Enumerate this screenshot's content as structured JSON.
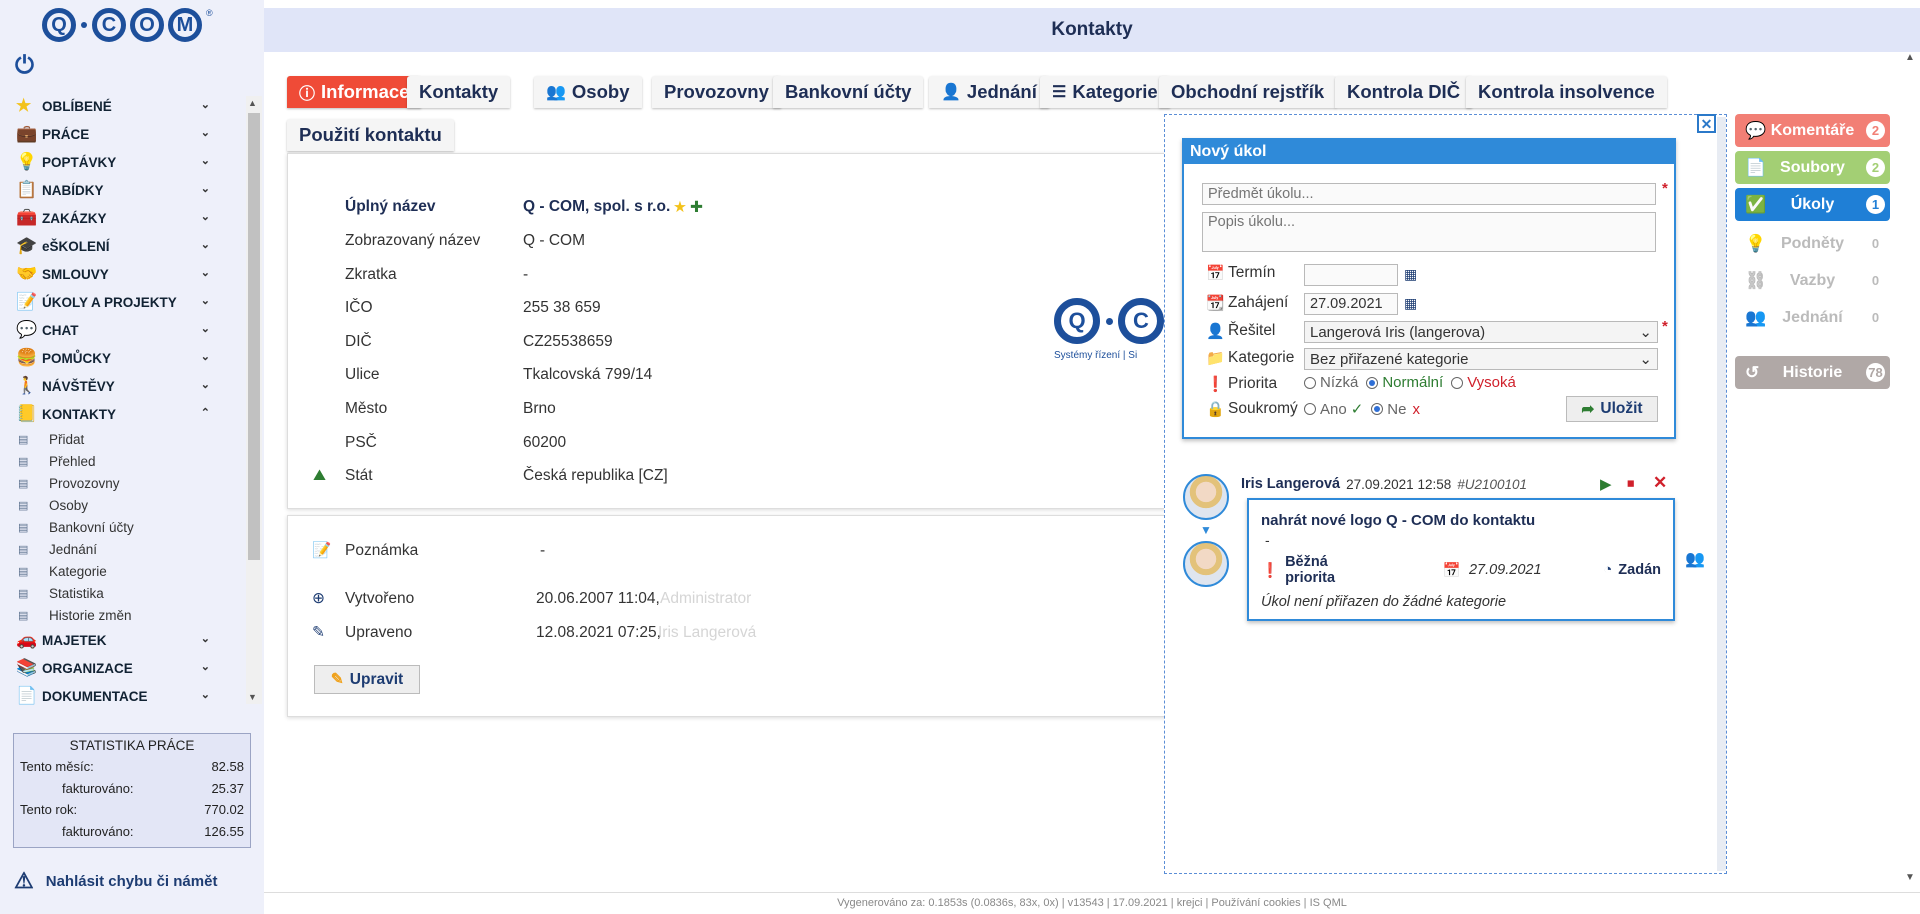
{
  "app": {
    "title": "Kontakty"
  },
  "logo": {
    "letters": [
      "Q",
      "C",
      "O",
      "M"
    ],
    "reg": "®"
  },
  "sidebar": {
    "items": [
      {
        "label": "OBLÍBENÉ",
        "icon": "star-icon",
        "glyph": "★",
        "color": "#f3c21a"
      },
      {
        "label": "PRÁCE",
        "icon": "briefcase-icon",
        "glyph": "💼",
        "color": "#b36a1a"
      },
      {
        "label": "POPTÁVKY",
        "icon": "lightbulb-icon",
        "glyph": "💡",
        "color": "#d5a11c"
      },
      {
        "label": "NABÍDKY",
        "icon": "clipboard-icon",
        "glyph": "📋",
        "color": "#2a5ea8"
      },
      {
        "label": "ZAKÁZKY",
        "icon": "toolbox-icon",
        "glyph": "🧰",
        "color": "#4d7ab0"
      },
      {
        "label": "eŠKOLENÍ",
        "icon": "graduation-cap-icon",
        "glyph": "🎓",
        "color": "#333"
      },
      {
        "label": "SMLOUVY",
        "icon": "handshake-icon",
        "glyph": "🤝",
        "color": "#4b7fb6"
      },
      {
        "label": "ÚKOLY A PROJEKTY",
        "icon": "task-clipboard-icon",
        "glyph": "📝",
        "color": "#1d4f9b"
      },
      {
        "label": "CHAT",
        "icon": "chat-icon",
        "glyph": "💬",
        "color": "#3fa0d8"
      },
      {
        "label": "POMŮCKY",
        "icon": "burger-icon",
        "glyph": "🍔",
        "color": "#c7862b"
      },
      {
        "label": "NÁVŠTĚVY",
        "icon": "walking-person-icon",
        "glyph": "🚶",
        "color": "#1d4f9b"
      },
      {
        "label": "KONTAKTY",
        "icon": "address-book-icon",
        "glyph": "📒",
        "color": "#5a6f8c"
      }
    ],
    "kontakty_sub": [
      "Přidat",
      "Přehled",
      "Provozovny",
      "Osoby",
      "Bankovní účty",
      "Jednání",
      "Kategorie",
      "Statistika",
      "Historie změn"
    ],
    "items_after": [
      {
        "label": "MAJETEK",
        "icon": "car-icon",
        "glyph": "🚗",
        "color": "#c62828"
      },
      {
        "label": "ORGANIZACE",
        "icon": "books-icon",
        "glyph": "📚",
        "color": "#2e7d32"
      },
      {
        "label": "DOKUMENTACE",
        "icon": "document-icon",
        "glyph": "📄",
        "color": "#d5a11c"
      }
    ]
  },
  "stats": {
    "title": "STATISTIKA PRÁCE",
    "month_label": "Tento měsíc:",
    "month_value": "82.58",
    "month_billed_label": "fakturováno:",
    "month_billed_value": "25.37",
    "year_label": "Tento rok:",
    "year_value": "770.02",
    "year_billed_label": "fakturováno:",
    "year_billed_value": "126.55"
  },
  "report_label": "Nahlásit chybu či námět",
  "tabs": [
    {
      "label": "Informace",
      "icon": "info-icon",
      "glyph": "ⓘ"
    },
    {
      "label": "Kontakty",
      "icon": "",
      "glyph": ""
    },
    {
      "label": "Osoby",
      "icon": "people-icon",
      "glyph": "👥"
    },
    {
      "label": "Provozovny",
      "icon": "",
      "glyph": ""
    },
    {
      "label": "Bankovní účty",
      "icon": "",
      "glyph": ""
    },
    {
      "label": "Jednání",
      "icon": "meeting-icon",
      "glyph": "👤"
    },
    {
      "label": "Kategorie",
      "icon": "list-icon",
      "glyph": "☰"
    },
    {
      "label": "Obchodní rejstřík",
      "icon": "",
      "glyph": ""
    },
    {
      "label": "Kontrola DIČ",
      "icon": "",
      "glyph": ""
    },
    {
      "label": "Kontrola insolvence",
      "icon": "",
      "glyph": ""
    },
    {
      "label": "Použití kontaktu",
      "icon": "",
      "glyph": ""
    }
  ],
  "contact": {
    "fields": [
      {
        "label": "Úplný název",
        "value": "Q - COM, spol. s r.o."
      },
      {
        "label": "Zobrazovaný název",
        "value": "Q - COM"
      },
      {
        "label": "Zkratka",
        "value": "-"
      },
      {
        "label": "IČO",
        "value": "255 38 659"
      },
      {
        "label": "DIČ",
        "value": "CZ25538659"
      },
      {
        "label": "Ulice",
        "value": "Tkalcovská 799/14"
      },
      {
        "label": "Město",
        "value": "Brno"
      },
      {
        "label": "PSČ",
        "value": "60200"
      },
      {
        "label": "Stát",
        "value": "Česká republika [CZ]"
      }
    ],
    "logo_tagline": "Systémy řízení | Si",
    "note_label": "Poznámka",
    "note_value": "-",
    "created_label": "Vytvořeno",
    "created_value": "20.06.2007 11:04,",
    "created_by": "Administrator",
    "updated_label": "Upraveno",
    "updated_value": "12.08.2021 07:25,",
    "updated_by": "Iris Langerová",
    "edit_label": "Upravit"
  },
  "task_form": {
    "title": "Nový úkol",
    "subject_placeholder": "Předmět úkolu...",
    "description_placeholder": "Popis úkolu...",
    "deadline_label": "Termín",
    "deadline_value": "",
    "start_label": "Zahájení",
    "start_value": "27.09.2021",
    "solver_label": "Řešitel",
    "solver_value": "Langerová Iris (langerova)",
    "category_label": "Kategorie",
    "category_value": "Bez přiřazené kategorie",
    "priority_label": "Priorita",
    "priority_low": "Nízká",
    "priority_normal": "Normální",
    "priority_high": "Vysoká",
    "private_label": "Soukromý",
    "private_yes": "Ano",
    "private_no": "Ne",
    "save_label": "Uložit"
  },
  "task": {
    "author": "Iris Langerová",
    "date": "27.09.2021 12:58",
    "code": "#U2100101",
    "title": "nahrát nové logo Q - COM do kontaktu",
    "desc": "-",
    "priority": "Běžná priorita",
    "due": "27.09.2021",
    "state": "Zadán",
    "category_note": "Úkol není přiřazen do žádné kategorie"
  },
  "rightbar": [
    {
      "label": "Komentáře",
      "count": "2",
      "color": "#f27f75",
      "icon": "comment-icon",
      "glyph": "💬"
    },
    {
      "label": "Soubory",
      "count": "2",
      "color": "#a3cf74",
      "icon": "file-icon",
      "glyph": "📄"
    },
    {
      "label": "Úkoly",
      "count": "1",
      "color": "#1f7fd6",
      "icon": "task-icon",
      "glyph": "✅"
    },
    {
      "label": "Podněty",
      "count": "0",
      "color": "",
      "icon": "lightbulb-icon",
      "glyph": "💡"
    },
    {
      "label": "Vazby",
      "count": "0",
      "color": "",
      "icon": "links-icon",
      "glyph": "⛓"
    },
    {
      "label": "Jednání",
      "count": "0",
      "color": "",
      "icon": "people-icon",
      "glyph": "👥"
    },
    {
      "label": "Historie",
      "count": "78",
      "color": "#b0a8a6",
      "icon": "history-icon",
      "glyph": "↺"
    }
  ],
  "footer": "Vygenerováno za: 0.1853s (0.0836s, 83x, 0x) | v13543 | 17.09.2021 | krejci | Používání cookies | IS QML"
}
